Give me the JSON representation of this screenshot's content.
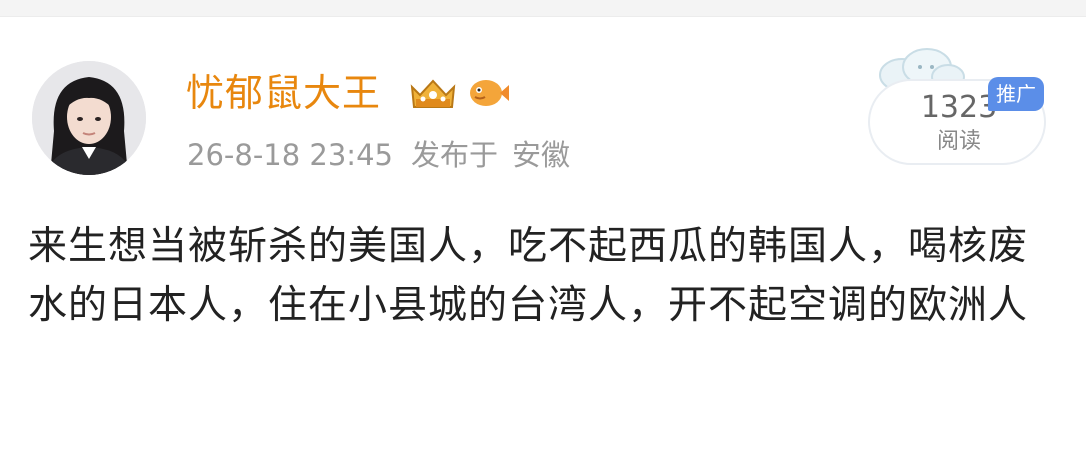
{
  "post": {
    "username": "忧郁鼠大王",
    "timestamp": "26-8-18 23:45",
    "published_label": "发布于",
    "location": "安徽",
    "read_count": "1323",
    "read_label": "阅读",
    "promo_tag": "推广",
    "content": "来生想当被斩杀的美国人，吃不起西瓜的韩国人，喝核废水的日本人，住在小县城的台湾人，开不起空调的欧洲人",
    "badges": [
      "crown-badge-icon",
      "fish-badge-icon"
    ]
  },
  "colors": {
    "username": "#e8870e",
    "meta": "#9a9a9a",
    "content": "#222222",
    "promo_tag": "#5b8ee8"
  }
}
